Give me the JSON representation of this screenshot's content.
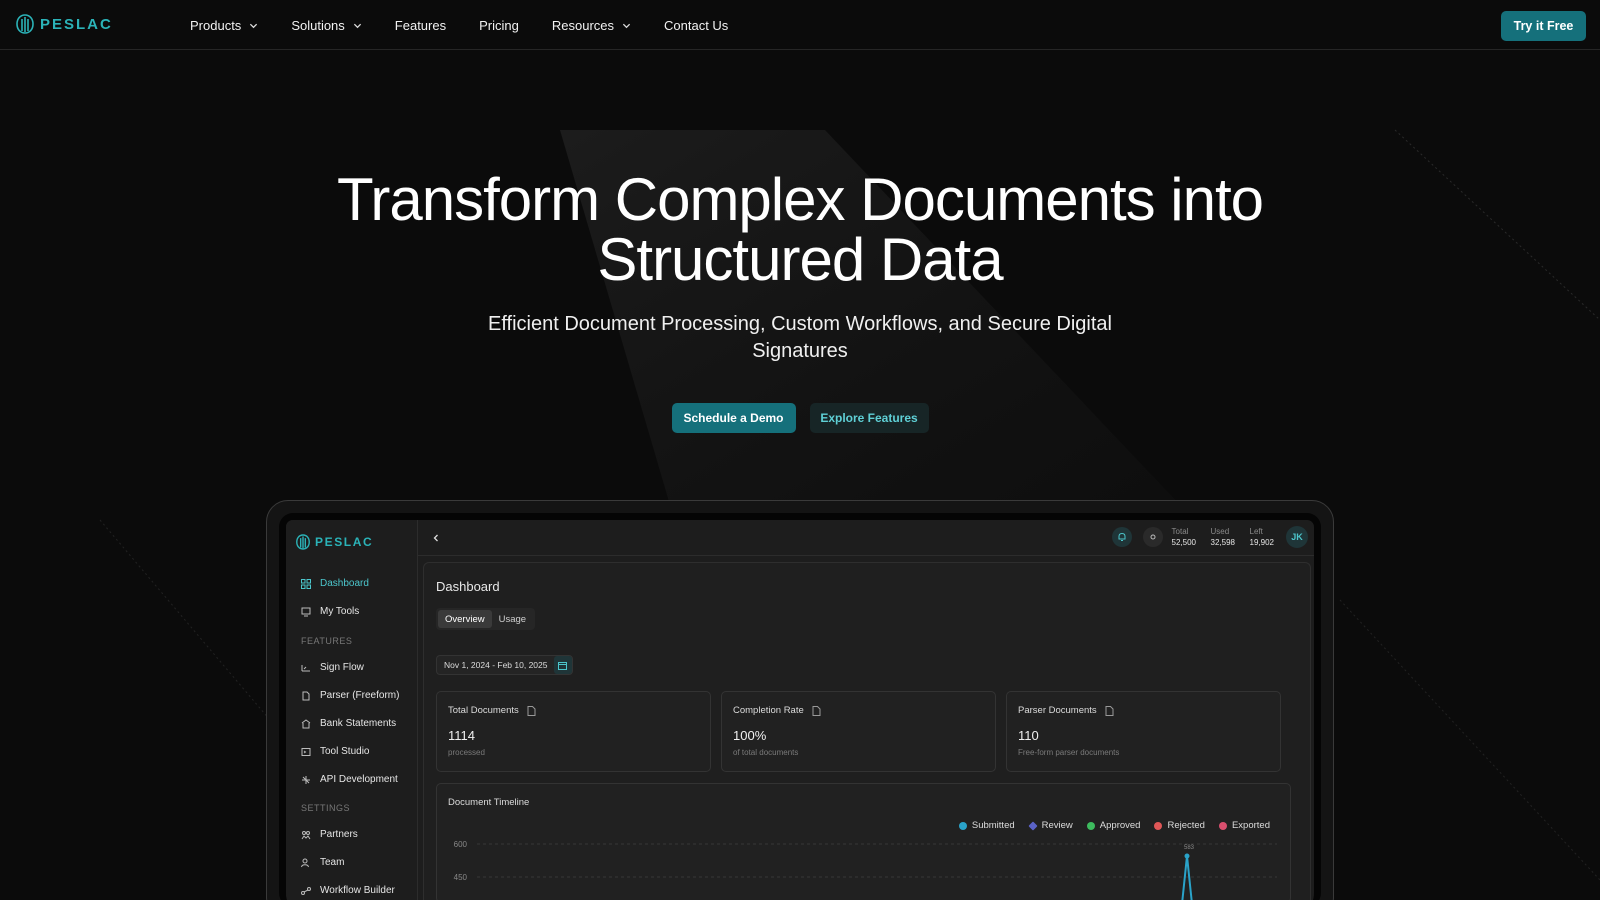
{
  "nav": {
    "brand": "PESLAC",
    "links": [
      {
        "label": "Products",
        "dropdown": true
      },
      {
        "label": "Solutions",
        "dropdown": true
      },
      {
        "label": "Features",
        "dropdown": false
      },
      {
        "label": "Pricing",
        "dropdown": false
      },
      {
        "label": "Resources",
        "dropdown": true
      },
      {
        "label": "Contact Us",
        "dropdown": false
      }
    ],
    "cta": "Try it Free"
  },
  "hero": {
    "title_line1": "Transform Complex Documents into",
    "title_line2": "Structured Data",
    "subtitle": "Efficient Document Processing, Custom Workflows, and Secure Digital Signatures",
    "primary_cta": "Schedule a Demo",
    "secondary_cta": "Explore Features"
  },
  "app": {
    "brand": "PESLAC",
    "sidebar": {
      "main": [
        {
          "label": "Dashboard",
          "icon": "dashboard-icon",
          "active": true
        },
        {
          "label": "My Tools",
          "icon": "tools-icon",
          "active": false
        }
      ],
      "features_heading": "FEATURES",
      "features": [
        {
          "label": "Sign Flow",
          "icon": "sign-icon"
        },
        {
          "label": "Parser (Freeform)",
          "icon": "document-icon"
        },
        {
          "label": "Bank Statements",
          "icon": "bank-icon"
        },
        {
          "label": "Tool Studio",
          "icon": "studio-icon"
        },
        {
          "label": "API Development",
          "icon": "api-icon"
        }
      ],
      "settings_heading": "SETTINGS",
      "settings": [
        {
          "label": "Partners",
          "icon": "partners-icon"
        },
        {
          "label": "Team",
          "icon": "team-icon"
        },
        {
          "label": "Workflow Builder",
          "icon": "workflow-icon"
        }
      ]
    },
    "topbar": {
      "quota": [
        {
          "label": "Total",
          "value": "52,500"
        },
        {
          "label": "Used",
          "value": "32,598"
        },
        {
          "label": "Left",
          "value": "19,902"
        }
      ],
      "avatar_initials": "JK"
    },
    "dashboard": {
      "title": "Dashboard",
      "tabs": [
        {
          "label": "Overview",
          "active": true
        },
        {
          "label": "Usage",
          "active": false
        }
      ],
      "date_range": "Nov 1, 2024 - Feb 10, 2025",
      "stats": [
        {
          "title": "Total Documents",
          "value": "1114",
          "sub": "processed"
        },
        {
          "title": "Completion Rate",
          "value": "100%",
          "sub": "of total documents"
        },
        {
          "title": "Parser Documents",
          "value": "110",
          "sub": "Free-form parser documents"
        }
      ],
      "timeline": {
        "title": "Document Timeline",
        "legend": [
          {
            "label": "Submitted",
            "color": "#2aa3c9"
          },
          {
            "label": "Review",
            "color": "#5a62c6"
          },
          {
            "label": "Approved",
            "color": "#3dbb5e"
          },
          {
            "label": "Rejected",
            "color": "#e05757"
          },
          {
            "label": "Exported",
            "color": "#d94f6e"
          }
        ],
        "y_ticks": [
          "600",
          "450"
        ],
        "peak_label": "583"
      }
    }
  },
  "colors": {
    "accent": "#15707b",
    "accent_text": "#2bb3b8",
    "background": "#0b0b0b"
  }
}
